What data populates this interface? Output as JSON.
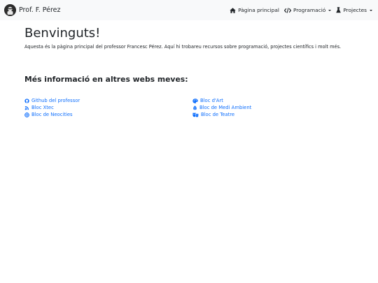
{
  "navbar": {
    "brand": "Prof. F. Pérez",
    "items": [
      {
        "label": "Pàgina principal",
        "icon": "home-icon",
        "dropdown": false
      },
      {
        "label": "Programació",
        "icon": "code-icon",
        "dropdown": true
      },
      {
        "label": "Projectes",
        "icon": "flask-icon",
        "dropdown": true
      }
    ]
  },
  "main": {
    "title": "Benvinguts!",
    "intro": "Aquesta és la pàgina principal del professor Francesc Pérez. Aquí hi trobareu recursos sobre programació, projectes científics i molt més.",
    "more_title": "Més informació en altres webs meves:"
  },
  "links_left": [
    {
      "label": "Github del professor",
      "icon": "github-icon"
    },
    {
      "label": "Bloc Xtec",
      "icon": "blog-icon"
    },
    {
      "label": "Bloc de Neocities",
      "icon": "globe-icon"
    }
  ],
  "links_right": [
    {
      "label": "Bloc d'Art",
      "icon": "palette-icon"
    },
    {
      "label": "Bloc de Medi Ambient",
      "icon": "leaf-icon"
    },
    {
      "label": "Bloc de Teatre",
      "icon": "theater-masks-icon"
    }
  ],
  "colors": {
    "navbar_bg": "#f8f9fa",
    "link": "#0d6efd",
    "text": "#212529"
  }
}
